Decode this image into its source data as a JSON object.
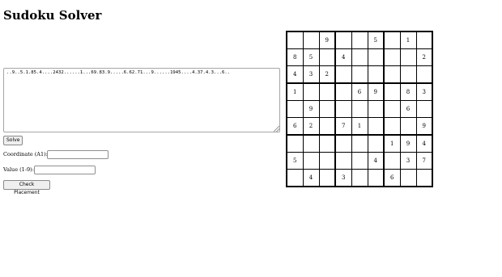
{
  "title": "Sudoku Solver",
  "puzzle_text": "..9..5.1.85.4....2432......1...69.83.9.....6.62.71...9......1945....4.37.4.3...6..",
  "solve_label": "Solve",
  "coordinate_label": "Coordinate (A1):",
  "coordinate_value": "",
  "value_label": "Value (1-9):",
  "value_value": "",
  "check_label": "Check Placement",
  "grid": [
    [
      "",
      "",
      "9",
      "",
      "",
      "5",
      "",
      "1",
      ""
    ],
    [
      "8",
      "5",
      "",
      "4",
      "",
      "",
      "",
      "",
      "2"
    ],
    [
      "4",
      "3",
      "2",
      "",
      "",
      "",
      "",
      "",
      ""
    ],
    [
      "1",
      "",
      "",
      "",
      "6",
      "9",
      "",
      "8",
      "3"
    ],
    [
      "",
      "9",
      "",
      "",
      "",
      "",
      "",
      "6",
      ""
    ],
    [
      "6",
      "2",
      "",
      "7",
      "1",
      "",
      "",
      "",
      "9"
    ],
    [
      "",
      "",
      "",
      "",
      "",
      "",
      "1",
      "9",
      "4"
    ],
    [
      "5",
      "",
      "",
      "",
      "",
      "4",
      "",
      "3",
      "7"
    ],
    [
      "",
      "4",
      "",
      "3",
      "",
      "",
      "6",
      "",
      ""
    ]
  ]
}
